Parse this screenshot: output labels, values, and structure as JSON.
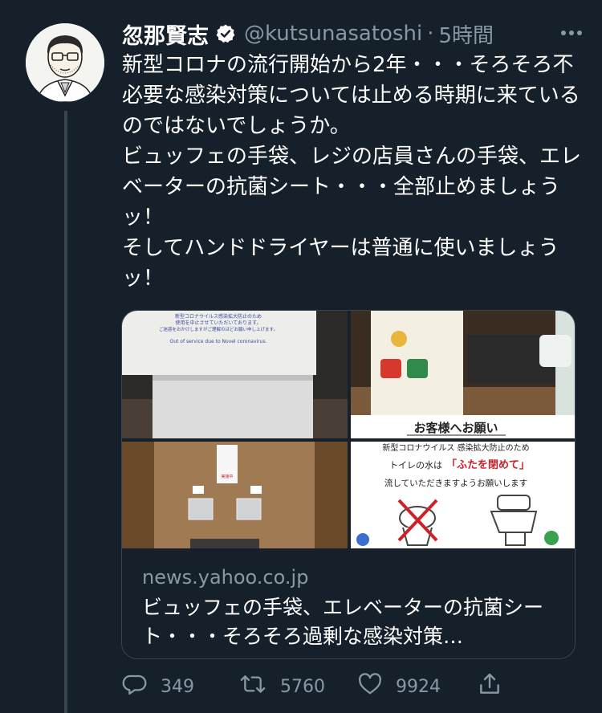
{
  "tweet": {
    "display_name": "忽那賢志",
    "handle": "@kutsunasatoshi",
    "separator": "·",
    "time": "5時間",
    "text": "新型コロナの流行開始から2年・・・そろそろ不必要な感染対策については止める時期に来ているのではないでしょうか。\nビュッフェの手袋、レジの店員さんの手袋、エレベーターの抗菌シート・・・全部止めましょうッ！\nそしてハンドドライヤーは普通に使いましょうッ！"
  },
  "card": {
    "domain": "news.yahoo.co.jp",
    "title": "ビュッフェの手袋、エレベーターの抗菌シート・・・そろそろ過剰な感染対策…",
    "image_text": {
      "notice_line1": "新型コロナウイルス感染拡大防止のため",
      "notice_line2": "使用を中止させていただいております。",
      "notice_line3": "ご迷惑をおかけしますがご理解のほどお願い申し上げます。",
      "notice_en": "Out of service due to Novel coronavirus.",
      "sign_title": "お客様へお願い",
      "sign_line1": "新型コロナウイルス 感染拡大防止のため",
      "sign_line2a": "トイレの水は",
      "sign_line2b": "「ふたを閉めて」",
      "sign_line3": "流していただきますようお願いします",
      "elevator_label": "実施中"
    }
  },
  "actions": {
    "reply_count": "349",
    "retweet_count": "5760",
    "like_count": "9924"
  },
  "icons": {
    "verified": "verified-badge-icon",
    "more": "more-icon",
    "reply": "reply-icon",
    "retweet": "retweet-icon",
    "like": "like-icon",
    "share": "share-icon"
  },
  "colors": {
    "background": "#15202b",
    "secondary_text": "#8899a6",
    "border": "#38444d",
    "sign_red": "#d0202a"
  }
}
